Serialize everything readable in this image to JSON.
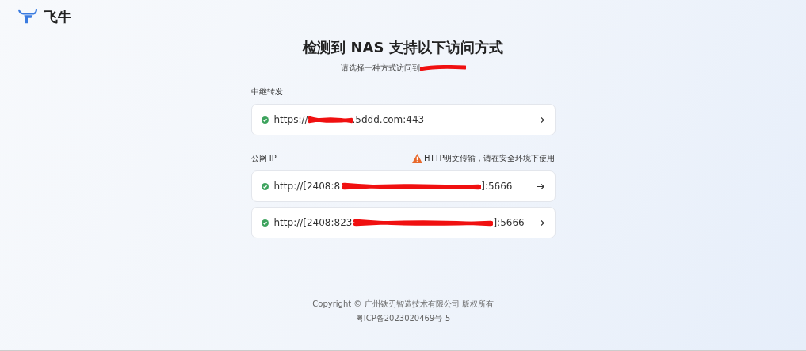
{
  "brand": {
    "name": "飞牛"
  },
  "heading": "检测到 NAS 支持以下访问方式",
  "subtitle": {
    "text": "请选择一种方式访问到",
    "redacted": true
  },
  "sections": [
    {
      "label": "中继转发",
      "links": [
        {
          "prefix": "https://",
          "suffix": ".5ddd.com:443",
          "ok": true,
          "redacted": true
        }
      ]
    },
    {
      "label": "公网 IP",
      "warning": "HTTP明文传输，请在安全环境下使用",
      "links": [
        {
          "prefix": "http://[2408:8",
          "suffix": "]:5666",
          "ok": true,
          "redacted": true
        },
        {
          "prefix": "http://[2408:823",
          "suffix": "]:5666",
          "ok": true,
          "redacted": true
        }
      ]
    }
  ],
  "footer": [
    "Copyright © 广州铁刃智造技术有限公司 版权所有",
    "粤ICP备2023020469号-5"
  ]
}
